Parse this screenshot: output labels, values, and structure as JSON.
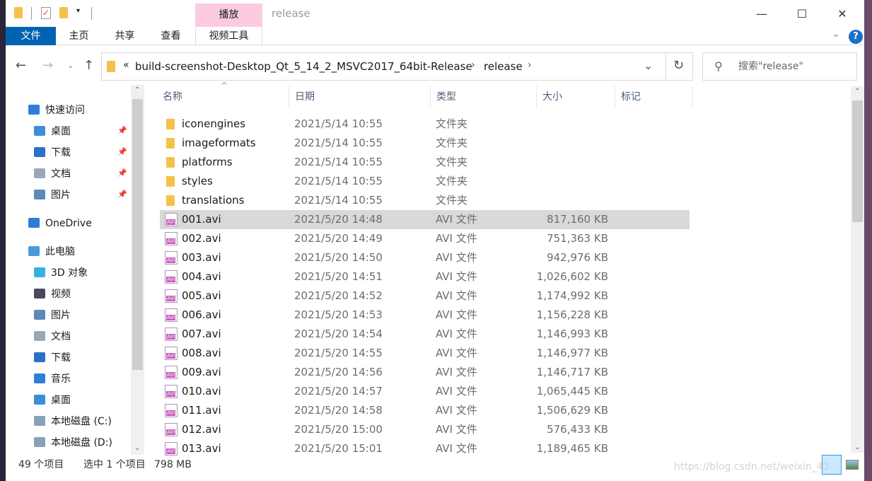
{
  "window": {
    "title": "release",
    "contextual_tab": "播放",
    "minimize": "—",
    "maximize": "☐",
    "close": "✕",
    "help": "?"
  },
  "ribbon": {
    "tabs": [
      "文件",
      "主页",
      "共享",
      "查看",
      "视频工具"
    ]
  },
  "address": {
    "prefix": "«",
    "path": [
      "build-screenshot-Desktop_Qt_5_14_2_MSVC2017_64bit-Release",
      "release"
    ],
    "search_placeholder": "搜索\"release\""
  },
  "nav": {
    "items": [
      {
        "label": "快速访问",
        "icon": "star-icon",
        "color": "#2f7fd8",
        "indent": 0,
        "pinned": false
      },
      {
        "label": "桌面",
        "icon": "desktop-icon",
        "color": "#3a8fd8",
        "indent": 1,
        "pinned": true
      },
      {
        "label": "下载",
        "icon": "download-icon",
        "color": "#2f6fc8",
        "indent": 1,
        "pinned": true
      },
      {
        "label": "文档",
        "icon": "document-icon",
        "color": "#9aa8b8",
        "indent": 1,
        "pinned": true
      },
      {
        "label": "图片",
        "icon": "picture-icon",
        "color": "#5a8ab8",
        "indent": 1,
        "pinned": true
      },
      {
        "label": "OneDrive",
        "icon": "cloud-icon",
        "color": "#2a7fd4",
        "indent": 0,
        "pinned": false
      },
      {
        "label": "此电脑",
        "icon": "computer-icon",
        "color": "#4a9ad8",
        "indent": 0,
        "pinned": false
      },
      {
        "label": "3D 对象",
        "icon": "cube-icon",
        "color": "#3ab0e0",
        "indent": 1,
        "pinned": false
      },
      {
        "label": "视频",
        "icon": "video-icon",
        "color": "#4a4a5a",
        "indent": 1,
        "pinned": false
      },
      {
        "label": "图片",
        "icon": "picture-icon",
        "color": "#5a8ab8",
        "indent": 1,
        "pinned": false
      },
      {
        "label": "文档",
        "icon": "document-icon",
        "color": "#9aa8b8",
        "indent": 1,
        "pinned": false
      },
      {
        "label": "下载",
        "icon": "download-icon",
        "color": "#2f6fc8",
        "indent": 1,
        "pinned": false
      },
      {
        "label": "音乐",
        "icon": "music-icon",
        "color": "#2f7fd8",
        "indent": 1,
        "pinned": false
      },
      {
        "label": "桌面",
        "icon": "desktop-icon",
        "color": "#3a8fd8",
        "indent": 1,
        "pinned": false
      },
      {
        "label": "本地磁盘 (C:)",
        "icon": "drive-icon",
        "color": "#8aa0b8",
        "indent": 1,
        "pinned": false
      },
      {
        "label": "本地磁盘 (D:)",
        "icon": "drive-icon",
        "color": "#8aa0b8",
        "indent": 1,
        "pinned": false
      }
    ]
  },
  "columns": [
    "名称",
    "日期",
    "类型",
    "大小",
    "标记"
  ],
  "files": [
    {
      "name": "iconengines",
      "date": "2021/5/14 10:55",
      "type": "文件夹",
      "size": "",
      "kind": "folder"
    },
    {
      "name": "imageformats",
      "date": "2021/5/14 10:55",
      "type": "文件夹",
      "size": "",
      "kind": "folder"
    },
    {
      "name": "platforms",
      "date": "2021/5/14 10:55",
      "type": "文件夹",
      "size": "",
      "kind": "folder"
    },
    {
      "name": "styles",
      "date": "2021/5/14 10:55",
      "type": "文件夹",
      "size": "",
      "kind": "folder"
    },
    {
      "name": "translations",
      "date": "2021/5/14 10:55",
      "type": "文件夹",
      "size": "",
      "kind": "folder"
    },
    {
      "name": "001.avi",
      "date": "2021/5/20 14:48",
      "type": "AVI 文件",
      "size": "817,160 KB",
      "kind": "avi",
      "selected": true
    },
    {
      "name": "002.avi",
      "date": "2021/5/20 14:49",
      "type": "AVI 文件",
      "size": "751,363 KB",
      "kind": "avi"
    },
    {
      "name": "003.avi",
      "date": "2021/5/20 14:50",
      "type": "AVI 文件",
      "size": "942,976 KB",
      "kind": "avi"
    },
    {
      "name": "004.avi",
      "date": "2021/5/20 14:51",
      "type": "AVI 文件",
      "size": "1,026,602 KB",
      "kind": "avi"
    },
    {
      "name": "005.avi",
      "date": "2021/5/20 14:52",
      "type": "AVI 文件",
      "size": "1,174,992 KB",
      "kind": "avi"
    },
    {
      "name": "006.avi",
      "date": "2021/5/20 14:53",
      "type": "AVI 文件",
      "size": "1,156,228 KB",
      "kind": "avi"
    },
    {
      "name": "007.avi",
      "date": "2021/5/20 14:54",
      "type": "AVI 文件",
      "size": "1,146,993 KB",
      "kind": "avi"
    },
    {
      "name": "008.avi",
      "date": "2021/5/20 14:55",
      "type": "AVI 文件",
      "size": "1,146,977 KB",
      "kind": "avi"
    },
    {
      "name": "009.avi",
      "date": "2021/5/20 14:56",
      "type": "AVI 文件",
      "size": "1,146,717 KB",
      "kind": "avi"
    },
    {
      "name": "010.avi",
      "date": "2021/5/20 14:57",
      "type": "AVI 文件",
      "size": "1,065,445 KB",
      "kind": "avi"
    },
    {
      "name": "011.avi",
      "date": "2021/5/20 14:58",
      "type": "AVI 文件",
      "size": "1,506,629 KB",
      "kind": "avi"
    },
    {
      "name": "012.avi",
      "date": "2021/5/20 15:00",
      "type": "AVI 文件",
      "size": "576,433 KB",
      "kind": "avi"
    },
    {
      "name": "013.avi",
      "date": "2021/5/20 15:01",
      "type": "AVI 文件",
      "size": "1,189,465 KB",
      "kind": "avi"
    }
  ],
  "status": {
    "count": "49 个项目",
    "selection": "选中 1 个项目",
    "size": "798 MB"
  },
  "watermark": "https://blog.csdn.net/weixin_43",
  "colors": {
    "file_tab": "#0063b1",
    "context_tab": "#fccbe2",
    "selection": "#d9d9d9"
  }
}
